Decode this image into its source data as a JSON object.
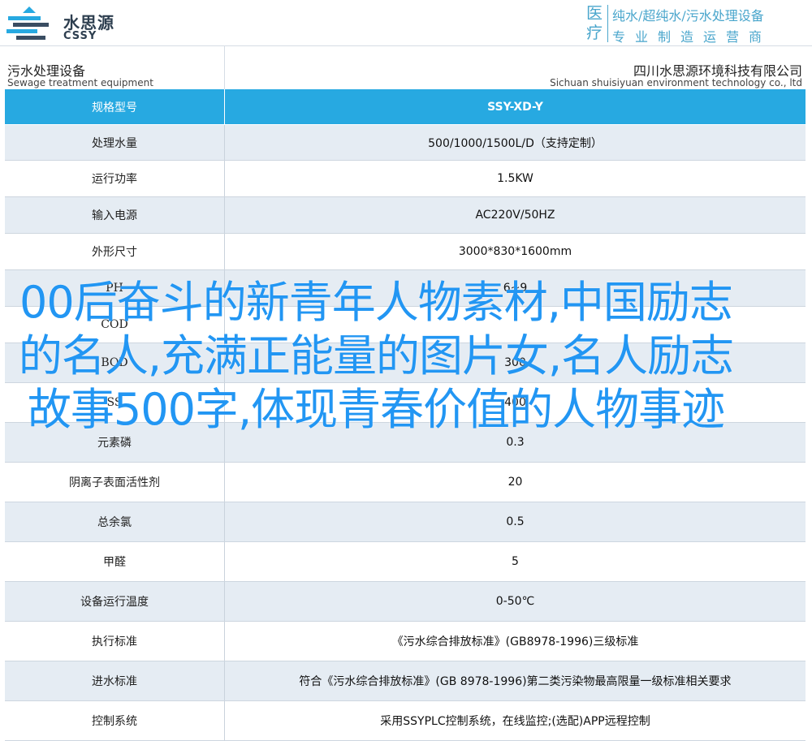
{
  "brand": {
    "name_cn": "水思源",
    "name_en": "CSSY",
    "tagline_badge": "医疗",
    "tagline_line1": "纯水/超纯水/污水处理设备",
    "tagline_line2": "专业制造运营商"
  },
  "title": {
    "left_cn": "污水处理设备",
    "left_en": "Sewage treatment equipment",
    "right_cn": "四川水思源环境科技有限公司",
    "right_en": "Sichuan shuisiyuan environment technology co., ltd"
  },
  "table": {
    "header": {
      "label": "规格型号",
      "value": "SSY-XD-Y"
    },
    "rows": [
      {
        "label": "处理水量",
        "value": "500/1000/1500L/D（支持定制）"
      },
      {
        "label": "运行功率",
        "value": "1.5KW"
      },
      {
        "label": "输入电源",
        "value": "AC220V/50HZ"
      },
      {
        "label": "外形尺寸",
        "value": "3000*830*1600mm"
      },
      {
        "label": "PH",
        "value": "6~9"
      },
      {
        "label": "COD",
        "value": ""
      },
      {
        "label": "BOD",
        "value": "300"
      },
      {
        "label": "SS",
        "value": "400"
      },
      {
        "label": "元素磷",
        "value": "0.3"
      },
      {
        "label": "阴离子表面活性剂",
        "value": "20"
      },
      {
        "label": "总余氯",
        "value": "0.5"
      },
      {
        "label": "甲醛",
        "value": "5"
      },
      {
        "label": "设备运行温度",
        "value": "0-50℃"
      },
      {
        "label": "执行标准",
        "value": "《污水综合排放标准》(GB8978-1996)三级标准"
      },
      {
        "label": "进水标准",
        "value": "符合《污水综合排放标准》(GB 8978-1996)第二类污染物最高限量一级标准相关要求"
      },
      {
        "label": "控制系统",
        "value": "采用SSYPLC控制系统，在线监控;(选配)APP远程控制"
      }
    ]
  },
  "overlay": {
    "headline": "00后奋斗的新青年人物素材,中国励志的名人,充满正能量的图片女,名人励志故事500字,体现青春价值的人物事迹"
  },
  "colors": {
    "header_row": "#27a9e1",
    "odd_row": "#e5ecf3",
    "accent": "#4aa6cc",
    "overlay_text": "#2296f3"
  }
}
